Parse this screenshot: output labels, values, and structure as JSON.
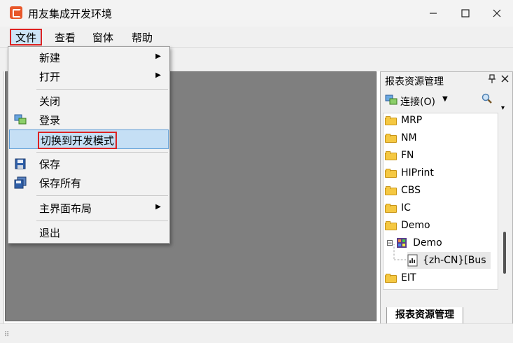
{
  "window": {
    "title": "用友集成开发环境",
    "controls": [
      "minimize",
      "maximize",
      "close"
    ]
  },
  "menubar": {
    "items": [
      "文件",
      "查看",
      "窗体",
      "帮助"
    ]
  },
  "file_menu": {
    "items": [
      {
        "label": "新建",
        "submenu": true
      },
      {
        "label": "打开",
        "submenu": true
      },
      {
        "label": "关闭"
      },
      {
        "label": "登录",
        "icon": "login-icon"
      },
      {
        "label": "切换到开发模式",
        "highlighted": true
      },
      {
        "label": "保存",
        "icon": "save-icon"
      },
      {
        "label": "保存所有",
        "icon": "save-all-icon"
      },
      {
        "label": "主界面布局",
        "submenu": true
      },
      {
        "label": "退出"
      }
    ]
  },
  "report_panel": {
    "title": "报表资源管理",
    "pin_glyph": "ᵩ",
    "close_glyph": "✕",
    "connect_label": "连接(O)",
    "tree": [
      {
        "label": "MRP",
        "type": "folder"
      },
      {
        "label": "NM",
        "type": "folder"
      },
      {
        "label": "FN",
        "type": "folder"
      },
      {
        "label": "HIPrint",
        "type": "folder"
      },
      {
        "label": "CBS",
        "type": "folder"
      },
      {
        "label": "IC",
        "type": "folder"
      },
      {
        "label": "Demo",
        "type": "folder"
      },
      {
        "label": "Demo",
        "type": "project",
        "expander": "⊟"
      },
      {
        "label": "{zh-CN}[Bus",
        "type": "report"
      },
      {
        "label": "EIT",
        "type": "folder"
      }
    ],
    "tab_label": "报表资源管理"
  },
  "colors": {
    "highlight_border": "#dd2222",
    "selection": "#c5dff5",
    "workspace": "#7f7f7f"
  }
}
